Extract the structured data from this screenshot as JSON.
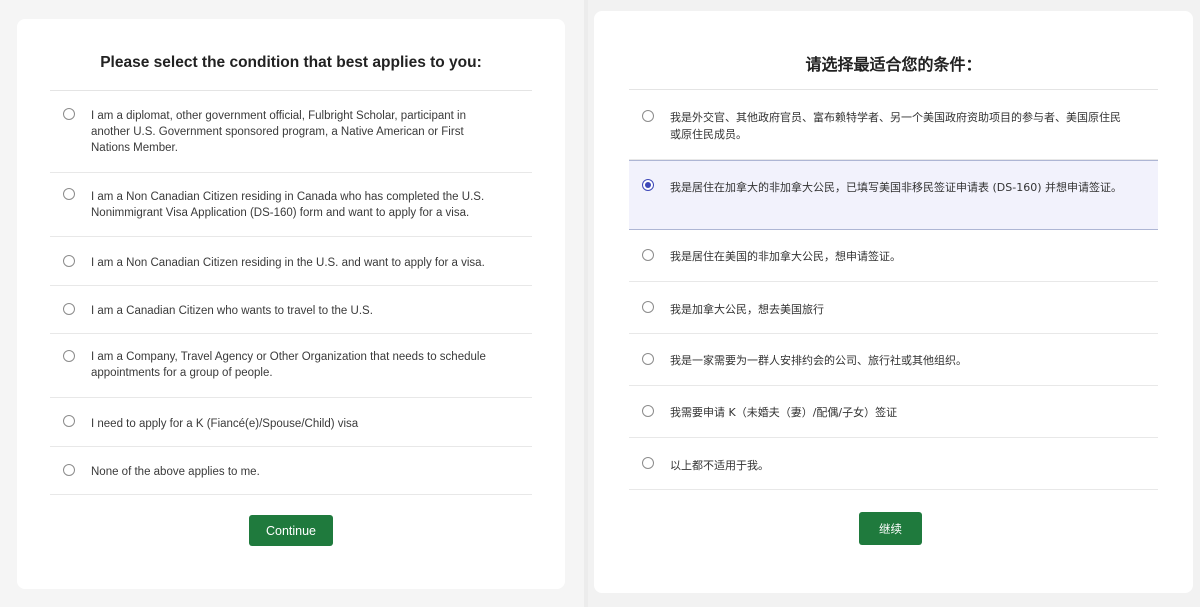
{
  "english_form": {
    "title": "Please select the condition that best applies to you:",
    "options": [
      {
        "label": "I am a diplomat, other government official, Fulbright Scholar, participant in another U.S. Government sponsored program, a Native American or First Nations Member.",
        "selected": false
      },
      {
        "label": "I am a Non Canadian Citizen residing in Canada who has completed the U.S. Nonimmigrant Visa Application (DS-160) form and want to apply for a visa.",
        "selected": false
      },
      {
        "label": "I am a Non Canadian Citizen residing in the U.S. and want to apply for a visa.",
        "selected": false
      },
      {
        "label": "I am a Canadian Citizen who wants to travel to the U.S.",
        "selected": false
      },
      {
        "label": "I am a Company, Travel Agency or Other Organization that needs to schedule appointments for a group of people.",
        "selected": false
      },
      {
        "label": "I need to apply for a K (Fiancé(e)/Spouse/Child) visa",
        "selected": false
      },
      {
        "label": "None of the above applies to me.",
        "selected": false
      }
    ],
    "continue_label": "Continue"
  },
  "chinese_form": {
    "title": "请选择最适合您的条件：",
    "options": [
      {
        "label": "我是外交官、其他政府官员、富布赖特学者、另一个美国政府资助项目的参与者、美国原住民或原住民成员。",
        "selected": false
      },
      {
        "label": "我是居住在加拿大的非加拿大公民，已填写美国非移民签证申请表 (DS-160) 并想申请签证。",
        "selected": true
      },
      {
        "label": "我是居住在美国的非加拿大公民，想申请签证。",
        "selected": false
      },
      {
        "label": "我是加拿大公民，想去美国旅行",
        "selected": false
      },
      {
        "label": "我是一家需要为一群人安排约会的公司、旅行社或其他组织。",
        "selected": false
      },
      {
        "label": "我需要申请 K（未婚夫（妻）/配偶/子女）签证",
        "selected": false
      },
      {
        "label": "以上都不适用于我。",
        "selected": false
      }
    ],
    "continue_label": "继续"
  },
  "colors": {
    "button": "#1f7a3d",
    "selected_radio": "#3e48b8",
    "selected_row": "#f2f2fc"
  }
}
